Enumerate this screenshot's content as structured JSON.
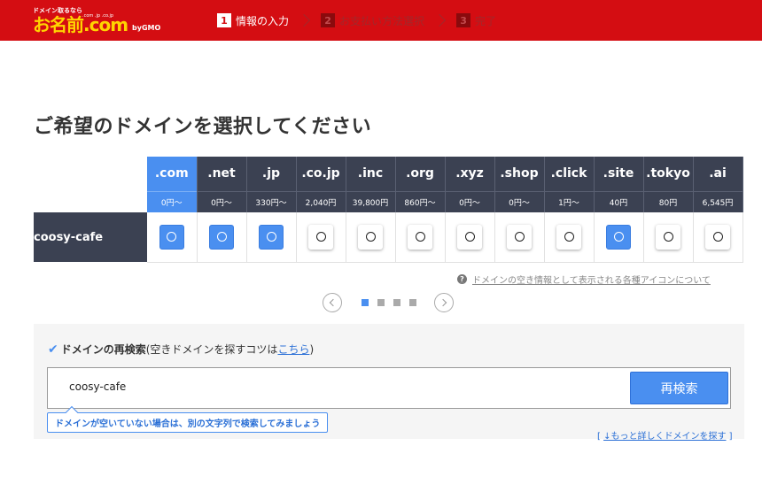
{
  "header": {
    "logo": {
      "tagline": "ドメイン取るなら",
      "brand": "お名前.com",
      "tlds": ".com .jp .co.jp",
      "gmo": "byGMO"
    },
    "steps": [
      {
        "num": "1",
        "label": "情報の入力",
        "active": true
      },
      {
        "num": "2",
        "label": "お支払い方法選択",
        "active": false
      },
      {
        "num": "3",
        "label": "完了",
        "active": false
      }
    ]
  },
  "page_title": "ご希望のドメインを選択してください",
  "table": {
    "domain": "coosy-cafe",
    "tlds": [
      {
        "name": ".com",
        "price": "0円〜",
        "available": true,
        "selected": true
      },
      {
        "name": ".net",
        "price": "0円〜",
        "available": true,
        "selected": false
      },
      {
        "name": ".jp",
        "price": "330円〜",
        "available": true,
        "selected": false
      },
      {
        "name": ".co.jp",
        "price": "2,040円",
        "available": false,
        "selected": false
      },
      {
        "name": ".inc",
        "price": "39,800円",
        "available": false,
        "selected": false
      },
      {
        "name": ".org",
        "price": "860円〜",
        "available": false,
        "selected": false
      },
      {
        "name": ".xyz",
        "price": "0円〜",
        "available": false,
        "selected": false
      },
      {
        "name": ".shop",
        "price": "0円〜",
        "available": false,
        "selected": false
      },
      {
        "name": ".click",
        "price": "1円〜",
        "available": false,
        "selected": false
      },
      {
        "name": ".site",
        "price": "40円",
        "available": true,
        "selected": false
      },
      {
        "name": ".tokyo",
        "price": "80円",
        "available": false,
        "selected": false
      },
      {
        "name": ".ai",
        "price": "6,545円",
        "available": false,
        "selected": false
      }
    ]
  },
  "info_link": "ドメインの空き情報として表示される各種アイコンについて",
  "pager": {
    "pages": 4,
    "current": 1
  },
  "search": {
    "heading_bold": "ドメインの再検索",
    "heading_pre": " (空きドメインを探すコツは",
    "heading_link": "こちら",
    "heading_post": ")",
    "value": "coosy-cafe",
    "button": "再検索",
    "tooltip": "ドメインが空いていない場合は、別の文字列で検索してみましょう"
  },
  "more_link": "↓もっと詳しくドメインを探す"
}
